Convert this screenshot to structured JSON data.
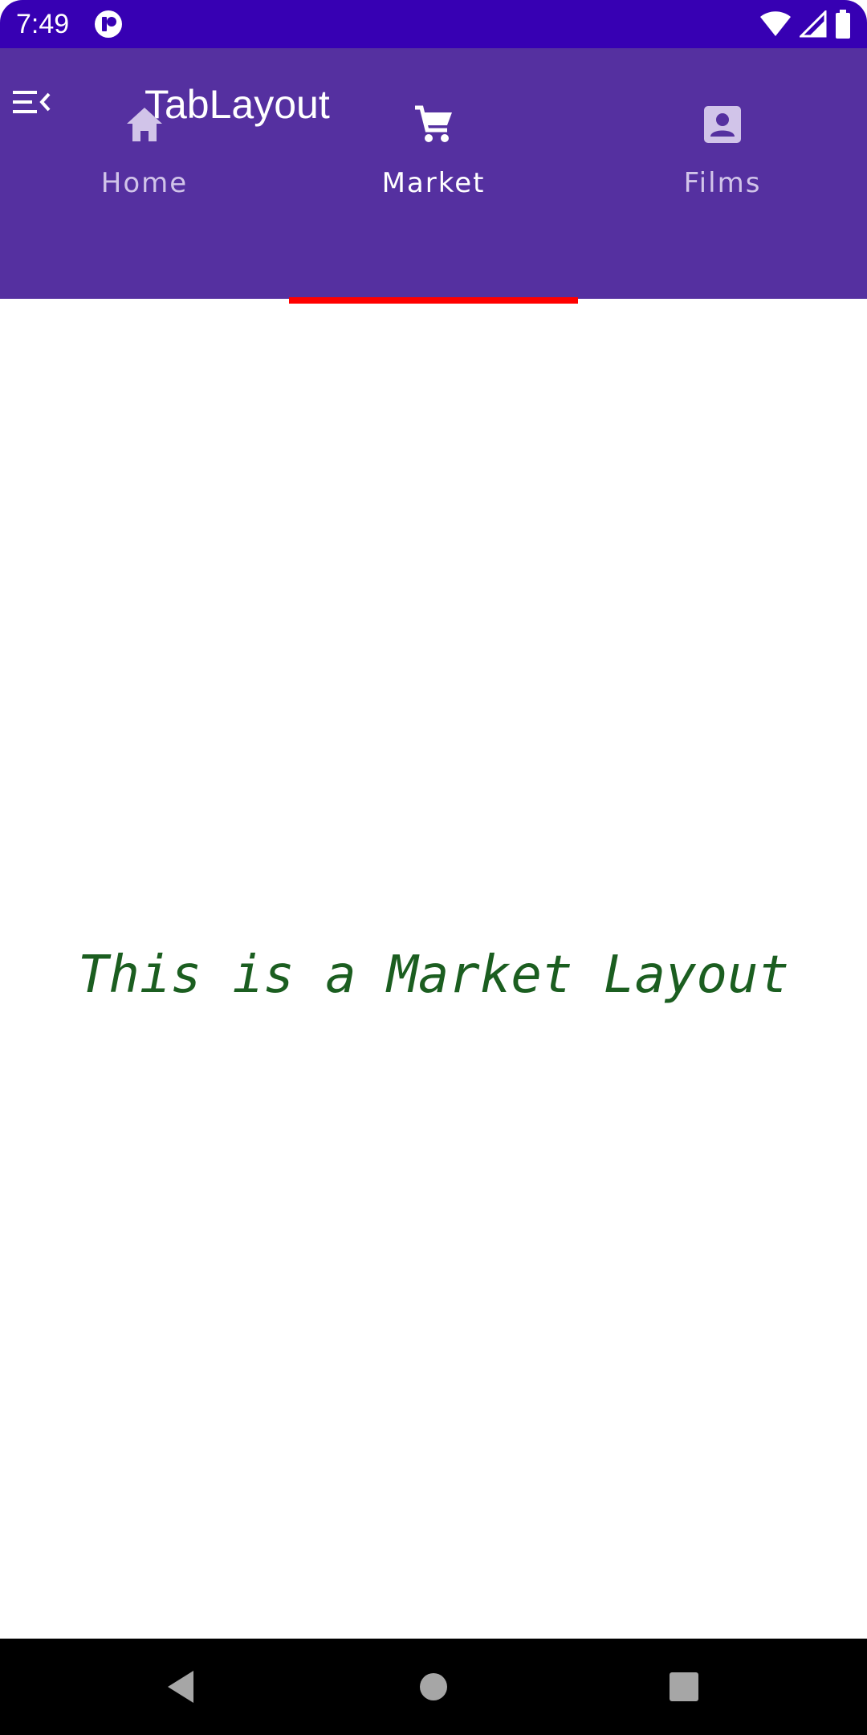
{
  "status_bar": {
    "time": "7:49",
    "icons": [
      "app-notification-icon",
      "wifi-icon",
      "cell-signal-icon",
      "battery-icon"
    ]
  },
  "app_bar": {
    "title": "TabLayout",
    "menu_icon": "menu-collapse-icon"
  },
  "tabs": [
    {
      "label": "Home",
      "icon": "home-icon",
      "selected": false
    },
    {
      "label": "Market",
      "icon": "cart-icon",
      "selected": true
    },
    {
      "label": "Films",
      "icon": "contact-icon",
      "selected": false
    }
  ],
  "content": {
    "text": "This is a Market Layout"
  },
  "nav_bar": {
    "buttons": [
      "back-icon",
      "home-circle-icon",
      "recents-icon"
    ]
  },
  "colors": {
    "status_bar": "#3700B3",
    "app_bar": "#5530A0",
    "indicator": "#FF0000",
    "content_text": "#1B5E20",
    "inactive_tab": "#D1C4E9"
  }
}
